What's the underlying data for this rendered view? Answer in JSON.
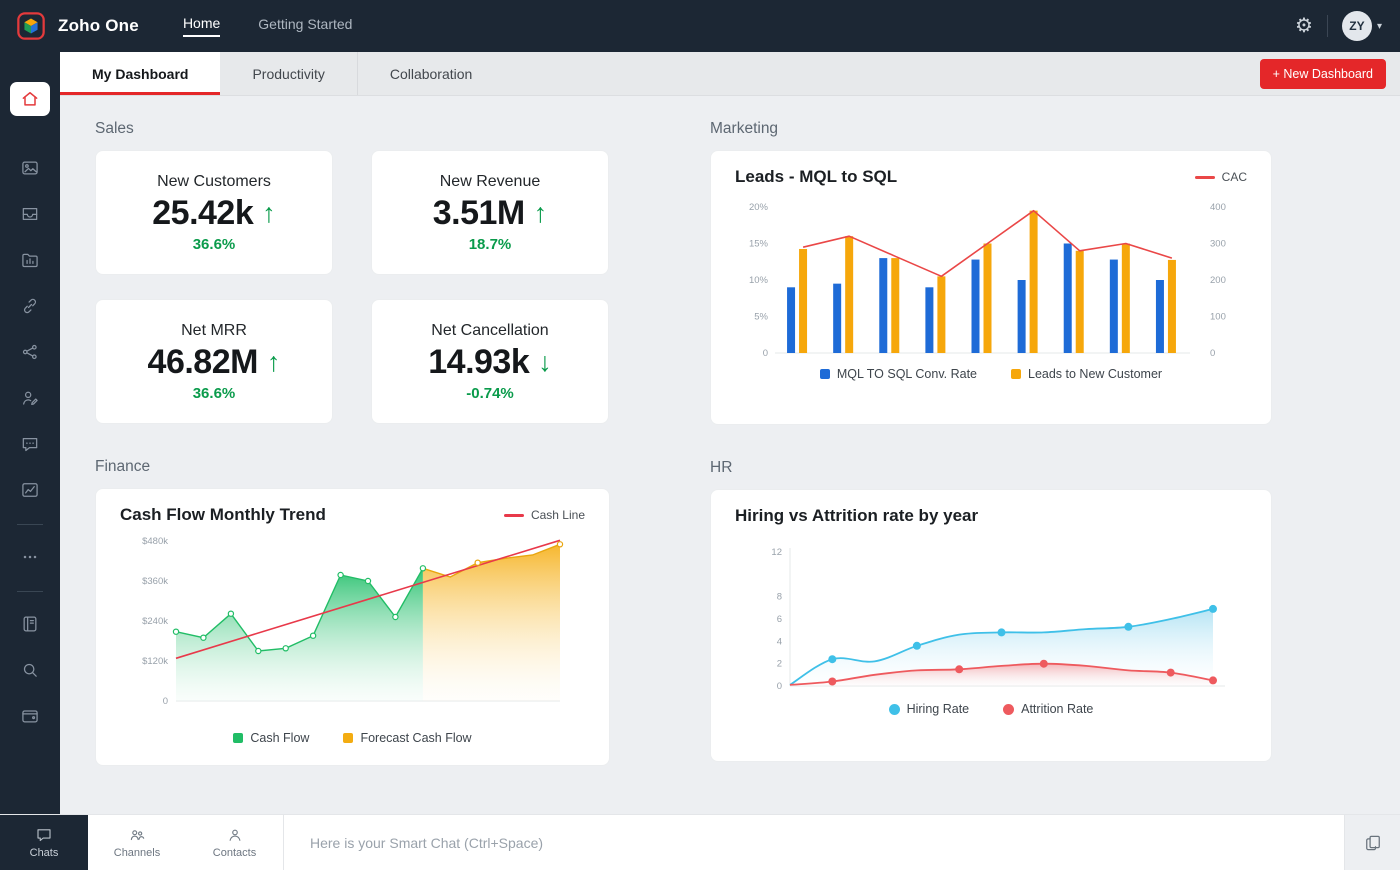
{
  "app": {
    "brand": "Zoho One"
  },
  "header": {
    "nav": [
      {
        "label": "Home",
        "active": true
      },
      {
        "label": "Getting Started",
        "active": false
      }
    ],
    "avatar_initials": "ZY"
  },
  "tabs": [
    {
      "label": "My Dashboard",
      "active": true
    },
    {
      "label": "Productivity",
      "active": false
    },
    {
      "label": "Collaboration",
      "active": false
    }
  ],
  "buttons": {
    "new_dashboard": "+ New Dashboard"
  },
  "sections": {
    "sales": "Sales",
    "marketing": "Marketing",
    "finance": "Finance",
    "hr": "HR"
  },
  "sales_cards": [
    {
      "title": "New Customers",
      "value": "25.42k",
      "arrow_glyph": "↑",
      "delta": "36.6%",
      "direction": "up"
    },
    {
      "title": "New Revenue",
      "value": "3.51M",
      "arrow_glyph": "↑",
      "delta": "18.7%",
      "direction": "up"
    },
    {
      "title": "Net MRR",
      "value": "46.82M",
      "arrow_glyph": "↑",
      "delta": "36.6%",
      "direction": "up"
    },
    {
      "title": "Net Cancellation",
      "value": "14.93k",
      "arrow_glyph": "↓",
      "delta": "-0.74%",
      "direction": "down"
    }
  ],
  "chart_data": [
    {
      "id": "marketing",
      "type": "bar",
      "title": "Leads - MQL to SQL",
      "top_legend": {
        "label": "CAC",
        "color": "#ea4747"
      },
      "left_axis": {
        "ticks": [
          "0",
          "5%",
          "10%",
          "15%",
          "20%"
        ],
        "max": 20
      },
      "right_axis": {
        "ticks": [
          "0",
          "100",
          "200",
          "300",
          "400"
        ],
        "max": 400
      },
      "series": [
        {
          "name": "MQL TO SQL Conv. Rate",
          "type": "bar",
          "axis": "left",
          "color": "#1e6bd7",
          "values": [
            9,
            9.5,
            13,
            9,
            12.8,
            10,
            15,
            12.8,
            10
          ]
        },
        {
          "name": "Leads to New Customer",
          "type": "bar",
          "axis": "right",
          "color": "#f6a70b",
          "values": [
            285,
            320,
            260,
            210,
            300,
            390,
            280,
            300,
            255
          ]
        },
        {
          "name": "CAC",
          "type": "line",
          "axis": "right",
          "color": "#ea4747",
          "values": [
            290,
            320,
            265,
            210,
            300,
            390,
            280,
            300,
            260
          ]
        }
      ],
      "legend_position": "bottom"
    },
    {
      "id": "finance",
      "type": "area",
      "title": "Cash Flow Monthly Trend",
      "top_legend": {
        "label": "Cash Line",
        "color": "#e8394a"
      },
      "y_axis": {
        "ticks": [
          "0",
          "$120k",
          "$240k",
          "$360k",
          "$480k"
        ],
        "max": 480
      },
      "series": [
        {
          "name": "Cash Flow",
          "color": "#21bd66",
          "values": [
            208,
            190,
            262,
            150,
            158,
            196,
            378,
            360,
            252,
            398
          ]
        },
        {
          "name": "Forecast Cash Flow",
          "color": "#f3ac11",
          "values": [
            398,
            372,
            415,
            428,
            438,
            470
          ],
          "starts_at_index": 9
        }
      ],
      "trend_line": {
        "name": "Cash Line",
        "color": "#e8394a",
        "from": 128,
        "to": 482
      },
      "legend_position": "bottom"
    },
    {
      "id": "hr",
      "type": "line",
      "title": "Hiring vs Attrition rate by year",
      "y_axis": {
        "ticks": [
          "0",
          "2",
          "4",
          "6",
          "8",
          "12"
        ],
        "max": 12
      },
      "series": [
        {
          "name": "Hiring Rate",
          "color": "#3fc0e8",
          "values": [
            0.1,
            2.4,
            2.2,
            3.6,
            4.6,
            4.8,
            4.8,
            5.1,
            5.3,
            6,
            6.9
          ],
          "marker_indices": [
            1,
            3,
            5,
            8,
            10
          ]
        },
        {
          "name": "Attrition Rate",
          "color": "#ee5a5e",
          "values": [
            0.1,
            0.4,
            1,
            1.4,
            1.5,
            1.8,
            2,
            1.8,
            1.4,
            1.2,
            0.5
          ],
          "marker_indices": [
            1,
            4,
            6,
            9,
            10
          ]
        }
      ],
      "legend_position": "bottom"
    }
  ],
  "sidebar": {
    "icons": [
      "home",
      "gallery",
      "inbox",
      "folder",
      "link",
      "network",
      "user-edit",
      "chat",
      "analytics",
      "more",
      "notebook",
      "search",
      "wallet"
    ]
  },
  "footer": {
    "tabs": [
      {
        "label": "Chats"
      },
      {
        "label": "Channels"
      },
      {
        "label": "Contacts"
      }
    ],
    "smart_chat_placeholder": "Here is your Smart Chat (Ctrl+Space)"
  },
  "colors": {
    "topbar_bg": "#1c2734",
    "accent_red": "#e42729",
    "positive_green": "#0a9b4b",
    "content_bg": "#edeff2"
  }
}
